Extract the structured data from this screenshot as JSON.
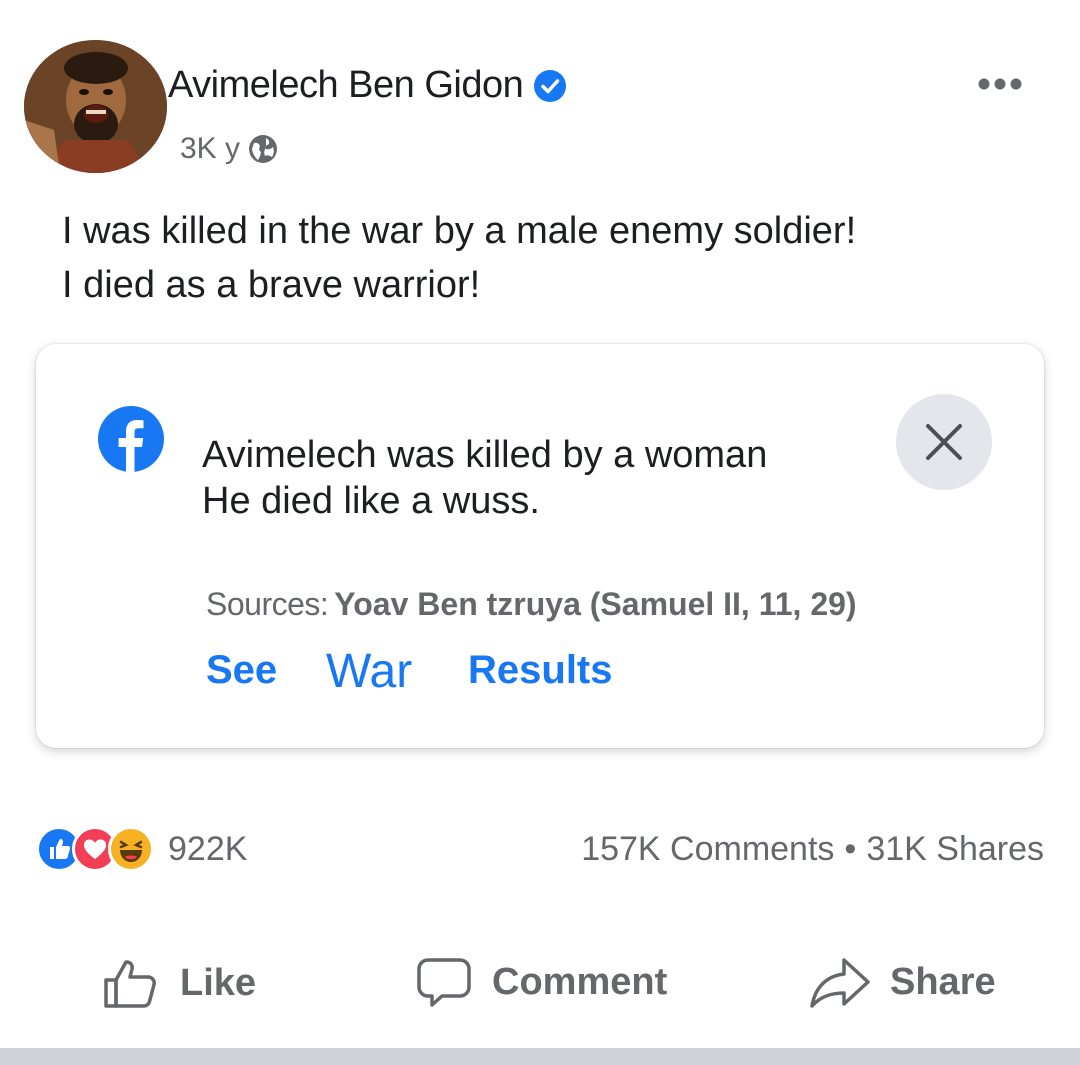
{
  "post": {
    "author": "Avimelech Ben Gidon",
    "time": "3K y",
    "text_lines": [
      "I was killed in the war by a male enemy soldier!",
      "I died as a brave warrior!"
    ]
  },
  "attachment": {
    "lines": [
      "Avimelech was killed by a woman",
      "He died like a wuss."
    ],
    "sources_label": "Sources:",
    "sources_value": "Yoav Ben tzruya (Samuel II, 11, 29)",
    "links": [
      "See",
      "War",
      "Results"
    ]
  },
  "engagement": {
    "reaction_count": "922K",
    "comments": "157K Comments",
    "separator": "•",
    "shares": "31K Shares"
  },
  "actions": {
    "like": "Like",
    "comment": "Comment",
    "share": "Share"
  },
  "colors": {
    "accent": "#1877f2",
    "muted_text": "#65676b",
    "love": "#f33e58",
    "haha": "#f7b125"
  },
  "icons": {
    "verified": "verified-badge-icon",
    "privacy": "globe-icon",
    "more": "more-options-icon",
    "brand": "facebook-logo-icon",
    "close": "close-icon",
    "reactions": [
      "like-reaction-icon",
      "love-reaction-icon",
      "haha-reaction-icon"
    ],
    "like": "thumbs-up-icon",
    "comment": "comment-bubble-icon",
    "share": "share-arrow-icon"
  }
}
